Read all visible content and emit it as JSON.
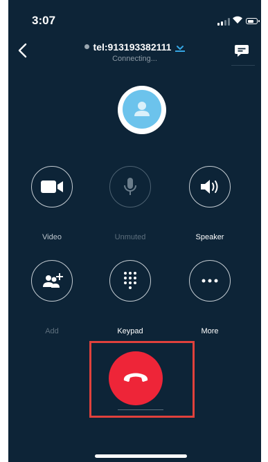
{
  "status_bar": {
    "time": "3:07"
  },
  "call": {
    "title": "tel:913193382111",
    "status": "Connecting..."
  },
  "controls": {
    "video": "Video",
    "mute": "Unmuted",
    "speaker": "Speaker",
    "add": "Add",
    "keypad": "Keypad",
    "more": "More"
  },
  "colors": {
    "background": "#0d2437",
    "accent": "#35a6e4",
    "end_call": "#ee2538",
    "highlight": "#e0413c"
  },
  "icons": {
    "back": "chevron-left-icon",
    "chat": "chat-bubble-icon",
    "video": "video-camera-icon",
    "mute": "microphone-icon",
    "speaker": "speaker-icon",
    "add": "add-person-icon",
    "keypad": "dialpad-icon",
    "more": "more-dots-icon",
    "end": "hang-up-icon"
  }
}
